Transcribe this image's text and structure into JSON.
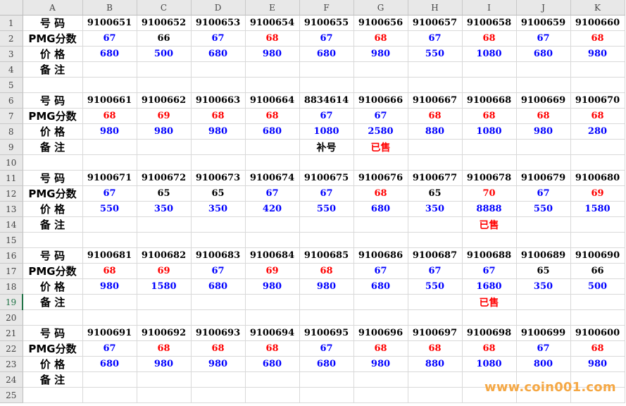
{
  "colors": {
    "black": "#000000",
    "red": "#ff0000",
    "blue": "#0000ff",
    "header_bg": "#e8e8e8",
    "grid": "#d9d9d9",
    "active_row": "#217346",
    "watermark": "#f5a845"
  },
  "columns": [
    "A",
    "B",
    "C",
    "D",
    "E",
    "F",
    "G",
    "H",
    "I",
    "J",
    "K"
  ],
  "labels": {
    "number": "号 码",
    "pmg": "PMG分数",
    "price": "价 格",
    "note": "备 注"
  },
  "active_row": 19,
  "watermark": "www.coin001.com",
  "blocks": [
    {
      "numbers": [
        "9100651",
        "9100652",
        "9100653",
        "9100654",
        "9100655",
        "9100656",
        "9100657",
        "9100658",
        "9100659",
        "9100660"
      ],
      "pmg": [
        {
          "v": "67",
          "c": "blue"
        },
        {
          "v": "66",
          "c": "black"
        },
        {
          "v": "67",
          "c": "blue"
        },
        {
          "v": "68",
          "c": "red"
        },
        {
          "v": "67",
          "c": "blue"
        },
        {
          "v": "68",
          "c": "red"
        },
        {
          "v": "67",
          "c": "blue"
        },
        {
          "v": "68",
          "c": "red"
        },
        {
          "v": "67",
          "c": "blue"
        },
        {
          "v": "68",
          "c": "red"
        }
      ],
      "price": [
        "680",
        "500",
        "680",
        "980",
        "680",
        "980",
        "550",
        "1080",
        "680",
        "980"
      ],
      "notes": [
        null,
        null,
        null,
        null,
        null,
        null,
        null,
        null,
        null,
        null
      ]
    },
    {
      "numbers": [
        "9100661",
        "9100662",
        "9100663",
        "9100664",
        "8834614",
        "9100666",
        "9100667",
        "9100668",
        "9100669",
        "9100670"
      ],
      "pmg": [
        {
          "v": "68",
          "c": "red"
        },
        {
          "v": "69",
          "c": "red"
        },
        {
          "v": "68",
          "c": "red"
        },
        {
          "v": "68",
          "c": "red"
        },
        {
          "v": "67",
          "c": "blue"
        },
        {
          "v": "67",
          "c": "blue"
        },
        {
          "v": "68",
          "c": "red"
        },
        {
          "v": "68",
          "c": "red"
        },
        {
          "v": "68",
          "c": "red"
        },
        {
          "v": "68",
          "c": "red"
        }
      ],
      "price": [
        "980",
        "980",
        "980",
        "680",
        "1080",
        "2580",
        "880",
        "1080",
        "980",
        "280"
      ],
      "notes": [
        null,
        null,
        null,
        null,
        {
          "v": "补号",
          "c": "black"
        },
        {
          "v": "已售",
          "c": "red"
        },
        null,
        null,
        null,
        null
      ]
    },
    {
      "numbers": [
        "9100671",
        "9100672",
        "9100673",
        "9100674",
        "9100675",
        "9100676",
        "9100677",
        "9100678",
        "9100679",
        "9100680"
      ],
      "pmg": [
        {
          "v": "67",
          "c": "blue"
        },
        {
          "v": "65",
          "c": "black"
        },
        {
          "v": "65",
          "c": "black"
        },
        {
          "v": "67",
          "c": "blue"
        },
        {
          "v": "67",
          "c": "blue"
        },
        {
          "v": "68",
          "c": "red"
        },
        {
          "v": "65",
          "c": "black"
        },
        {
          "v": "70",
          "c": "red"
        },
        {
          "v": "67",
          "c": "blue"
        },
        {
          "v": "69",
          "c": "red"
        }
      ],
      "price": [
        "550",
        "350",
        "350",
        "420",
        "550",
        "680",
        "350",
        "8888",
        "550",
        "1580"
      ],
      "notes": [
        null,
        null,
        null,
        null,
        null,
        null,
        null,
        {
          "v": "已售",
          "c": "red"
        },
        null,
        null
      ]
    },
    {
      "numbers": [
        "9100681",
        "9100682",
        "9100683",
        "9100684",
        "9100685",
        "9100686",
        "9100687",
        "9100688",
        "9100689",
        "9100690"
      ],
      "pmg": [
        {
          "v": "68",
          "c": "red"
        },
        {
          "v": "69",
          "c": "red"
        },
        {
          "v": "67",
          "c": "blue"
        },
        {
          "v": "69",
          "c": "red"
        },
        {
          "v": "68",
          "c": "red"
        },
        {
          "v": "67",
          "c": "blue"
        },
        {
          "v": "67",
          "c": "blue"
        },
        {
          "v": "67",
          "c": "blue"
        },
        {
          "v": "65",
          "c": "black"
        },
        {
          "v": "66",
          "c": "black"
        }
      ],
      "price": [
        "980",
        "1580",
        "680",
        "980",
        "980",
        "680",
        "550",
        "1680",
        "350",
        "500"
      ],
      "notes": [
        null,
        null,
        null,
        null,
        null,
        null,
        null,
        {
          "v": "已售",
          "c": "red"
        },
        null,
        null
      ]
    },
    {
      "numbers": [
        "9100691",
        "9100692",
        "9100693",
        "9100694",
        "9100695",
        "9100696",
        "9100697",
        "9100698",
        "9100699",
        "9100600"
      ],
      "pmg": [
        {
          "v": "67",
          "c": "blue"
        },
        {
          "v": "68",
          "c": "red"
        },
        {
          "v": "68",
          "c": "red"
        },
        {
          "v": "68",
          "c": "red"
        },
        {
          "v": "67",
          "c": "blue"
        },
        {
          "v": "68",
          "c": "red"
        },
        {
          "v": "68",
          "c": "red"
        },
        {
          "v": "68",
          "c": "red"
        },
        {
          "v": "67",
          "c": "blue"
        },
        {
          "v": "68",
          "c": "red"
        }
      ],
      "price": [
        "680",
        "980",
        "980",
        "680",
        "680",
        "980",
        "880",
        "1080",
        "800",
        "980"
      ],
      "notes": [
        null,
        null,
        null,
        null,
        null,
        null,
        null,
        null,
        null,
        null
      ]
    }
  ]
}
